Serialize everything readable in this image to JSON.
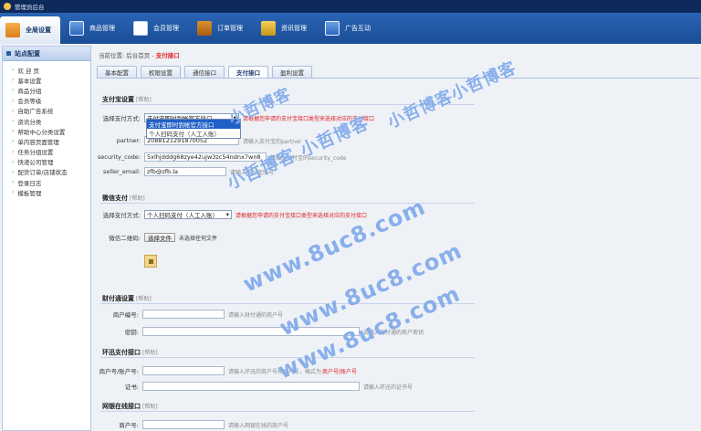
{
  "titlebar": {
    "text": "管理员后台"
  },
  "nav": [
    {
      "label": "全局设置",
      "icon": "settings-icon",
      "active": true
    },
    {
      "label": "商品管理",
      "icon": "goods-icon"
    },
    {
      "label": "会员管理",
      "icon": "member-icon"
    },
    {
      "label": "订单管理",
      "icon": "order-icon"
    },
    {
      "label": "资讯管理",
      "icon": "news-icon"
    },
    {
      "label": "广告互动",
      "icon": "ad-icon"
    }
  ],
  "sidebar": {
    "title": "站点配置",
    "items": [
      "欢 迎 页",
      "基本设置",
      "商品分组",
      "会员等级",
      "自助广告系统",
      "资讯分类",
      "帮助中心分类设置",
      "单内容页面管理",
      "任务分组设置",
      "快递公司管理",
      "配货订单/店铺状态",
      "登录日志",
      "模板管理"
    ]
  },
  "breadcrumb": {
    "prefix": "当前位置:",
    "home": "后台首页",
    "sep": " - ",
    "current": "支付接口"
  },
  "subtabs": [
    "基本配置",
    "权限设置",
    "通信接口",
    "支付接口",
    "盈利设置"
  ],
  "alipay": {
    "title": "支付宝设置",
    "note": "[帮助]",
    "method_label": "选择支付方式:",
    "method_value": "支付宝即时到帐官方接口",
    "method_hint": "请根据您申请的支付宝接口类型来选择对应的支付接口",
    "options": [
      "支付宝即时到帐官方接口",
      "个人扫码支付（人工入账）"
    ],
    "partner_label": "partner:",
    "partner_value": "2088121291870052",
    "partner_hint": "请输入支付宝的partner",
    "code_label": "security_code:",
    "code_value": "5xlhjdddg68zye42ujw3zc54ndnx7wn8",
    "code_hint": "请输入支付宝的security_code",
    "email_label": "seller_email:",
    "email_value": "zfb@zfb.la",
    "email_hint": "请输入支付宝账号"
  },
  "wechat": {
    "title": "微信支付",
    "note": "[帮助]",
    "method_label": "选择支付方式:",
    "method_value": "个人扫码支付（人工入账）",
    "method_hint": "请根据您申请的支付宝接口类型来选择对应的支付接口",
    "qr_label": "微信二维码:",
    "file_button": "选择文件",
    "file_status": "未选择任何文件"
  },
  "tenpay": {
    "title": "财付通设置",
    "note": "[帮助]",
    "account_label": "商户编号:",
    "account_hint": "请输入财付通的商户号",
    "key_label": "密钥:",
    "key_hint": "请输入财付通的商户密钥"
  },
  "huanxun": {
    "title": "环迅支付接口",
    "note": "[帮助]",
    "account_label": "商户号/账户号:",
    "account_hint": "请输入环迅的商户号和账户号，格式为",
    "account_hint_red": "商户号|账户号",
    "cert_label": "证书:",
    "cert_hint": "请输入环迅的证书号"
  },
  "chinabank": {
    "title": "网银在线接口",
    "note": "[帮助]",
    "account_label": "商户号:",
    "account_hint": "请输入网银在线的商户号"
  },
  "watermarks": [
    "小哲博客",
    "小哲博客 小哲博客",
    "小哲博客小哲博客",
    "www.8uc8.com",
    "www.8uc8.com",
    "www.8uc8.com"
  ]
}
